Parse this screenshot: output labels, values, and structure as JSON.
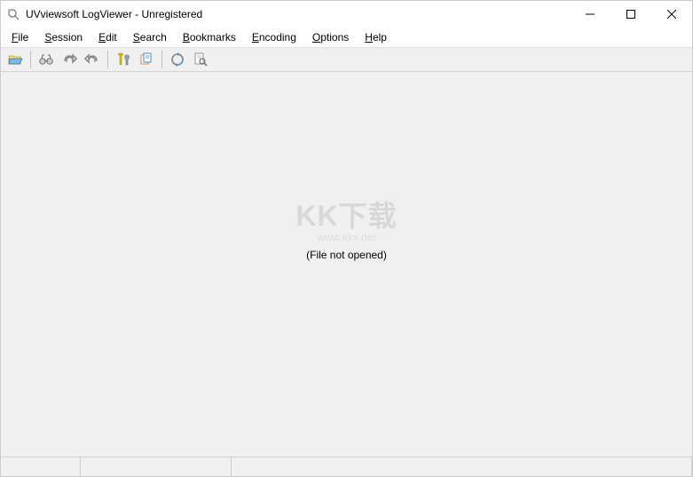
{
  "window": {
    "title": "UVviewsoft LogViewer - Unregistered"
  },
  "menu": {
    "items": [
      {
        "label": "File",
        "accel": "F"
      },
      {
        "label": "Session",
        "accel": "S"
      },
      {
        "label": "Edit",
        "accel": "E"
      },
      {
        "label": "Search",
        "accel": "S"
      },
      {
        "label": "Bookmarks",
        "accel": "B"
      },
      {
        "label": "Encoding",
        "accel": "E"
      },
      {
        "label": "Options",
        "accel": "O"
      },
      {
        "label": "Help",
        "accel": "H"
      }
    ]
  },
  "toolbar": {
    "buttons": [
      "open",
      "binoculars",
      "redo",
      "undo",
      "tools",
      "copy-doc",
      "refresh",
      "find-doc"
    ]
  },
  "content": {
    "watermark_main": "KK下载",
    "watermark_sub": "www.kkx.net",
    "message": "(File not opened)"
  },
  "statusbar": {
    "panes": [
      "",
      "",
      ""
    ]
  }
}
